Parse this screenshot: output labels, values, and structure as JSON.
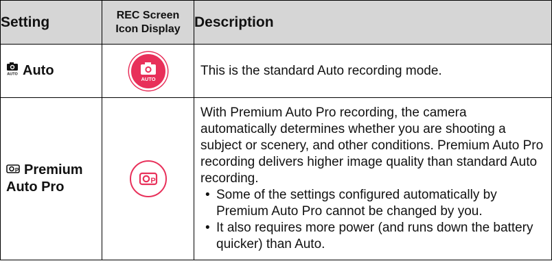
{
  "table": {
    "headers": {
      "setting": "Setting",
      "rec_icon_line1": "REC Screen",
      "rec_icon_line2": "Icon Display",
      "description": "Description"
    },
    "rows": [
      {
        "setting_label": "Auto",
        "setting_icon": "auto-camera-icon",
        "rec_icon": "auto-filled-circle-icon",
        "rec_icon_text": "AUTO",
        "description": "This is the standard Auto recording mode.",
        "bullets": []
      },
      {
        "setting_label_line1": "Premium",
        "setting_label_line2": "Auto Pro",
        "setting_icon": "premium-auto-pro-icon",
        "rec_icon": "premium-auto-pro-circle-icon",
        "description": "With Premium Auto Pro recording, the camera automatically determines whether you are shooting a subject or scenery, and other conditions. Premium Auto Pro recording delivers higher image quality than standard Auto recording.",
        "bullets": [
          "Some of the settings configured automatically by Premium Auto Pro cannot be changed by you.",
          "It also requires more power (and runs down the battery quicker) than Auto."
        ]
      }
    ]
  },
  "colors": {
    "header_bg": "#d6d6d6",
    "accent": "#e8305a",
    "border": "#000000"
  }
}
